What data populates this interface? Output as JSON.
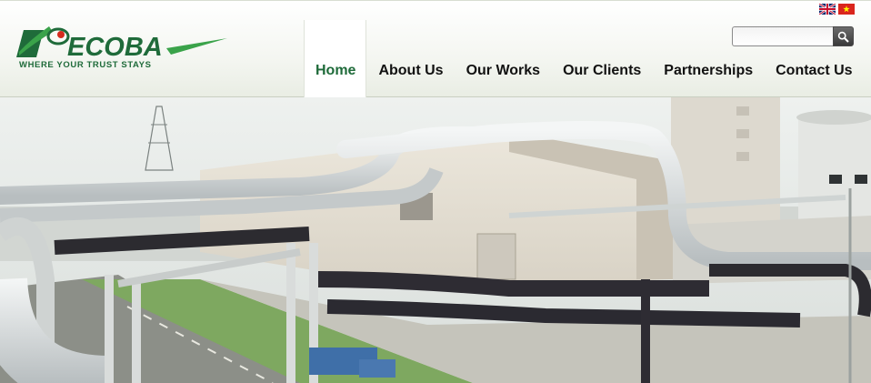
{
  "brand": {
    "name": "ECOBA",
    "tagline": "WHERE YOUR TRUST STAYS",
    "colors": {
      "green": "#1f6b3a",
      "light_green": "#3aa34a",
      "red": "#d52b1e"
    }
  },
  "languages": [
    {
      "code": "en",
      "icon": "uk-flag-icon"
    },
    {
      "code": "vi",
      "icon": "vietnam-flag-icon"
    }
  ],
  "search": {
    "placeholder": "",
    "value": "",
    "icon": "search-icon"
  },
  "nav": {
    "active_color": "#1f6b3a",
    "items": [
      {
        "label": "Home",
        "active": true
      },
      {
        "label": "About Us",
        "active": false
      },
      {
        "label": "Our Works",
        "active": false
      },
      {
        "label": "Our Clients",
        "active": false
      },
      {
        "label": "Partnerships",
        "active": false
      },
      {
        "label": "Contact Us",
        "active": false
      }
    ]
  },
  "hero": {
    "subject": "industrial-plant-pipework"
  }
}
